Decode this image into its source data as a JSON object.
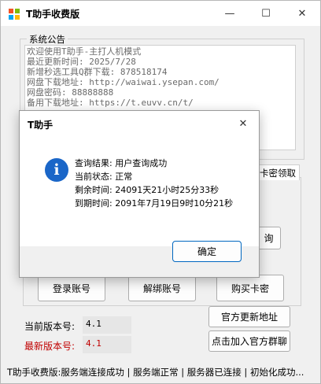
{
  "window": {
    "title": "T助手收费版",
    "minimize": "—",
    "maximize": "☐",
    "close": "✕"
  },
  "notice": {
    "group_label": "系统公告",
    "lines": [
      "欢迎使用T助手-主打人机模式",
      "最近更新时间: 2025/7/28",
      "新增秒选工具Q群下载: 878518174",
      "网盘下载地址: http://waiwai.ysepan.com/",
      "网盘密码: 88888888",
      "备用下载地址: https://t.euvv.cn/t/"
    ]
  },
  "tab_fragment": "卡密领取",
  "query_button_fragment": "询",
  "buttons": {
    "login": "登录账号",
    "unbind": "解绑账号",
    "buy_card": "购买卡密",
    "official_update": "官方更新地址",
    "join_group": "点击加入官方群聊"
  },
  "version": {
    "current_label": "当前版本号:",
    "current_value": "4.1",
    "latest_label": "最新版本号:",
    "latest_value": "4.1",
    "latest_color": "#c00000"
  },
  "statusbar": "T助手收费版:服务端连接成功 | 服务端正常 | 服务器已连接 | 初始化成功...",
  "dialog": {
    "title": "T助手",
    "close": "✕",
    "icon": "info-icon",
    "icon_glyph": "i",
    "lines": [
      "查询结果: 用户查询成功",
      "当前状态: 正常",
      "剩余时间: 24091天21小时25分33秒",
      "到期时间: 2091年7月19日9时10分21秒"
    ],
    "ok": "确定"
  }
}
